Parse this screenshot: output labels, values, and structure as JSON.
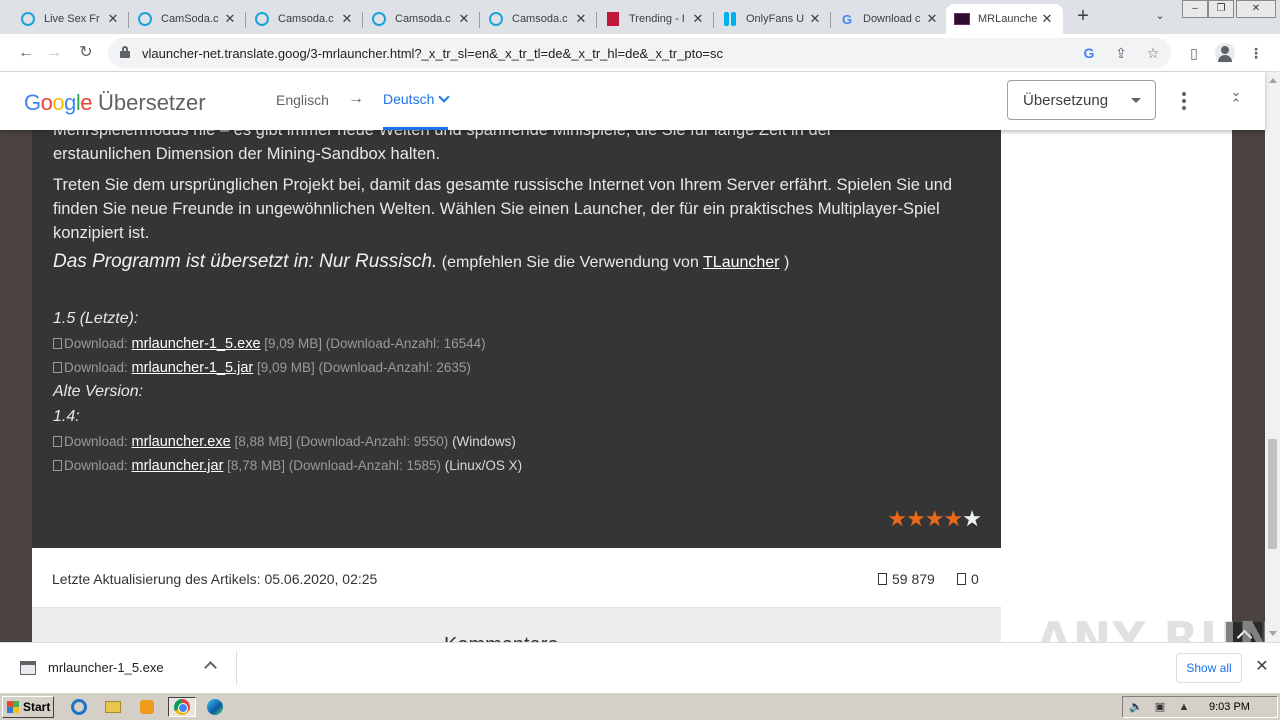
{
  "browser": {
    "tabs": [
      {
        "title": "Live Sex Fr",
        "icon": "camsoda-icon"
      },
      {
        "title": "CamSoda.c",
        "icon": "camsoda-icon"
      },
      {
        "title": "Camsoda.c",
        "icon": "camsoda-icon"
      },
      {
        "title": "Camsoda.c",
        "icon": "camsoda-icon"
      },
      {
        "title": "Camsoda.c",
        "icon": "camsoda-icon"
      },
      {
        "title": "Trending - I",
        "icon": "trending-icon"
      },
      {
        "title": "OnlyFans U",
        "icon": "onlyfans-icon"
      },
      {
        "title": "Download c",
        "icon": "google-icon"
      },
      {
        "title": "MRLaunche",
        "icon": "mrlauncher-icon",
        "active": true
      }
    ],
    "url": "vlauncher-net.translate.goog/3-mrlauncher.html?_x_tr_sl=en&_x_tr_tl=de&_x_tr_hl=de&_x_tr_pto=sc"
  },
  "translate": {
    "logo_google": "Google",
    "product": "Übersetzer",
    "source_lang": "Englisch",
    "arrow": "→",
    "target_lang": "Deutsch",
    "mode": "Übersetzung"
  },
  "article": {
    "clipped_line": "Mehrspielermodus nie – es gibt immer neue Welten und spannende Minispiele, die Sie für lange Zeit in der",
    "line_end": "erstaunlichen Dimension der Mining-Sandbox halten.",
    "paragraph": "Treten Sie dem ursprünglichen Projekt bei, damit das gesamte russische Internet von Ihrem Server erfährt. Spielen Sie und finden Sie neue Freunde in ungewöhnlichen Welten. Wählen Sie einen Launcher, der für ein praktisches Multiplayer-Spiel konzipiert ist.",
    "translated_label": "Das Programm ist übersetzt in: Nur Russisch.",
    "recommend_prefix": " (empfehlen Sie die Verwendung von ",
    "recommend_link": "TLauncher",
    "recommend_suffix": " )",
    "latest_heading": "1.5 (Letzte):",
    "old_heading": "Alte Version:",
    "old_version": "1.4:",
    "downloads": [
      {
        "prefix": "Download: ",
        "file": "mrlauncher-1_5.exe",
        "size": " [9,09 MB] ",
        "count": "(Download-Anzahl: 16544)",
        "os": ""
      },
      {
        "prefix": "Download: ",
        "file": "mrlauncher-1_5.jar",
        "size": " [9,09 MB] ",
        "count": "(Download-Anzahl: 2635)",
        "os": ""
      },
      {
        "prefix": "Download: ",
        "file": "mrlauncher.exe",
        "size": " [8,88 MB] ",
        "count": "(Download-Anzahl: 9550)",
        "os": " (Windows)"
      },
      {
        "prefix": "Download: ",
        "file": "mrlauncher.jar",
        "size": " [8,78 MB] ",
        "count": "(Download-Anzahl: 1585)",
        "os": " (Linux/OS X)"
      }
    ],
    "rating": {
      "filled": 4,
      "total": 5,
      "star_color": "#e8691a"
    }
  },
  "meta": {
    "updated_label": "Letzte Aktualisierung des Artikels: 05.06.2020, 02:25",
    "views": "59 879",
    "comments_count": "0"
  },
  "comments_heading": "Kommentare",
  "watermark": "ANY RUN",
  "download_shelf": {
    "file": "mrlauncher-1_5.exe",
    "show_all": "Show all"
  },
  "taskbar": {
    "start": "Start",
    "clock": "9:03 PM"
  },
  "colors": {
    "article_bg": "#353535",
    "page_bg": "#4a423e",
    "link_blue": "#1a73e8"
  }
}
